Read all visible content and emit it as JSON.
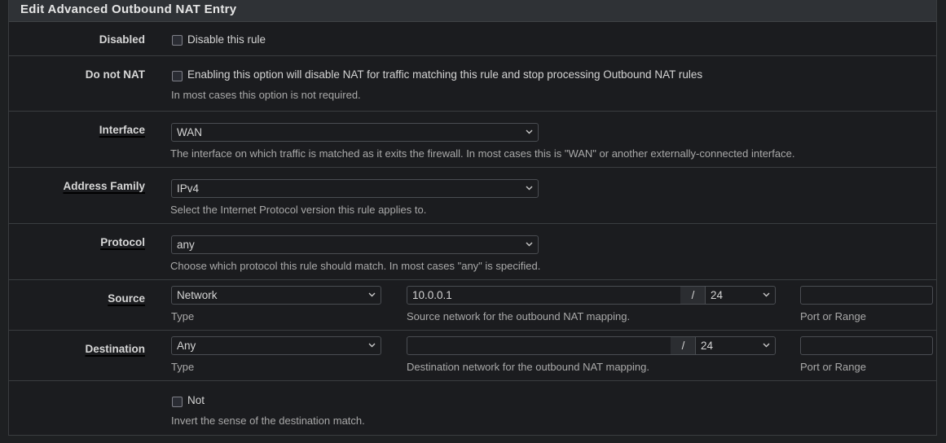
{
  "panel": {
    "title": "Edit Advanced Outbound NAT Entry"
  },
  "rows": {
    "disabled": {
      "label": "Disabled",
      "checkbox_label": "Disable this rule",
      "checked": false
    },
    "nonat": {
      "label": "Do not NAT",
      "checkbox_label": "Enabling this option will disable NAT for traffic matching this rule and stop processing Outbound NAT rules",
      "help": "In most cases this option is not required.",
      "checked": false
    },
    "interface": {
      "label": "Interface",
      "value": "WAN",
      "help": "The interface on which traffic is matched as it exits the firewall. In most cases this is \"WAN\" or another externally-connected interface."
    },
    "family": {
      "label": "Address Family",
      "value": "IPv4",
      "help": "Select the Internet Protocol version this rule applies to."
    },
    "protocol": {
      "label": "Protocol",
      "value": "any",
      "help": "Choose which protocol this rule should match. In most cases \"any\" is specified."
    },
    "source": {
      "label": "Source",
      "type_value": "Network",
      "type_help": "Type",
      "network_value": "10.0.0.1",
      "slash": "/",
      "mask_value": "24",
      "network_help": "Source network for the outbound NAT mapping.",
      "port_value": "",
      "port_help": "Port or Range"
    },
    "destination": {
      "label": "Destination",
      "type_value": "Any",
      "type_help": "Type",
      "network_value": "",
      "slash": "/",
      "mask_value": "24",
      "network_help": "Destination network for the outbound NAT mapping.",
      "port_value": "",
      "port_help": "Port or Range"
    },
    "not": {
      "checkbox_label": "Not",
      "help": "Invert the sense of the destination match.",
      "checked": false
    }
  },
  "icons": {
    "select_arrow": "chevron-down-icon",
    "checkbox": "checkbox-unchecked-icon"
  }
}
